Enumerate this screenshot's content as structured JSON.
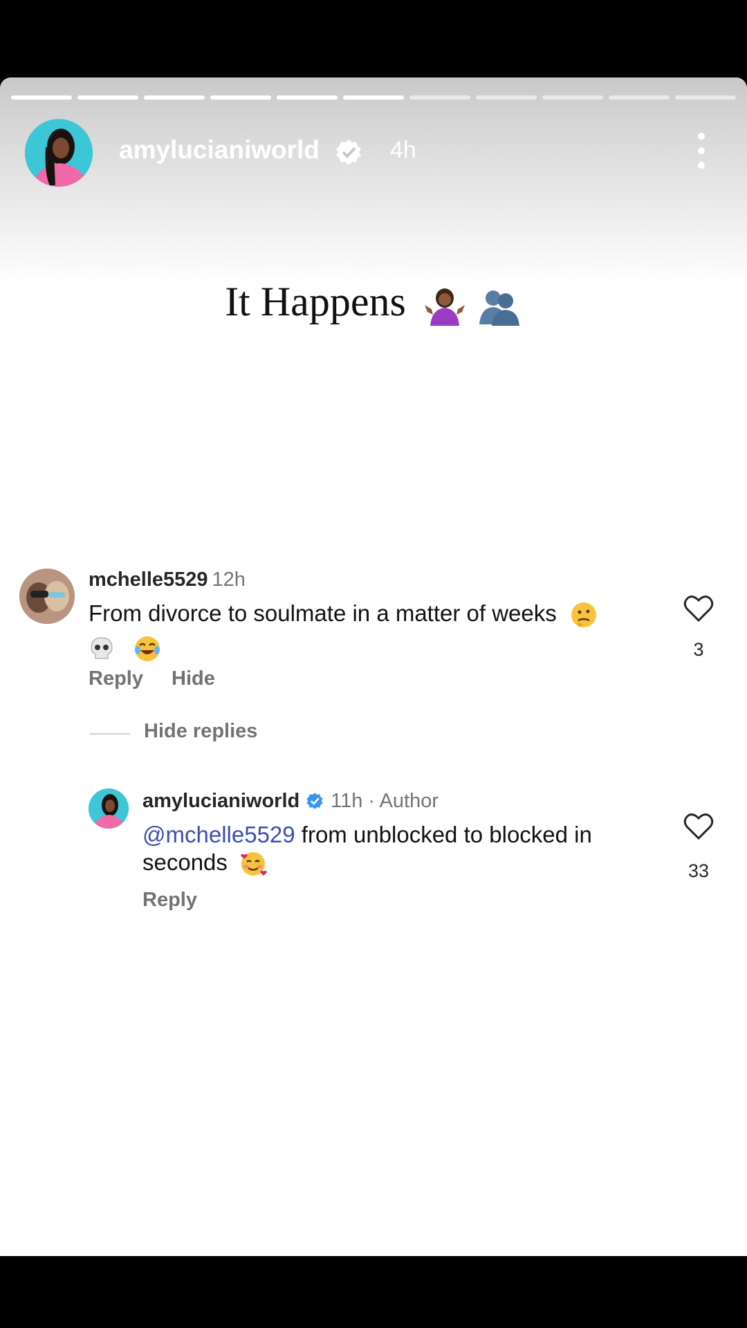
{
  "story": {
    "username": "amylucianiworld",
    "time": "4h",
    "title": "It Happens"
  },
  "comments": [
    {
      "username": "mchelle5529",
      "time": "12h",
      "text_line1": "From divorce to soulmate in a matter of weeks",
      "likes": "3",
      "reply_label": "Reply",
      "hide_label": "Hide",
      "hide_replies_label": "Hide replies"
    }
  ],
  "reply": {
    "username": "amylucianiworld",
    "meta": "11h · Author",
    "mention": "@mchelle5529",
    "text_line1": " from unblocked to blocked in",
    "text_line2": "seconds",
    "likes": "33",
    "reply_label": "Reply"
  },
  "colors": {
    "verified": "#3897f0",
    "mention": "#3a4fb1",
    "muted": "#737373"
  },
  "icons": [
    "verified-badge-icon",
    "more-options-icon",
    "heart-icon",
    "shrug-emoji-icon",
    "busts-emoji-icon",
    "thinking-emoji-icon",
    "skull-emoji-icon",
    "laughing-emoji-icon",
    "smiling-hearts-emoji-icon"
  ]
}
